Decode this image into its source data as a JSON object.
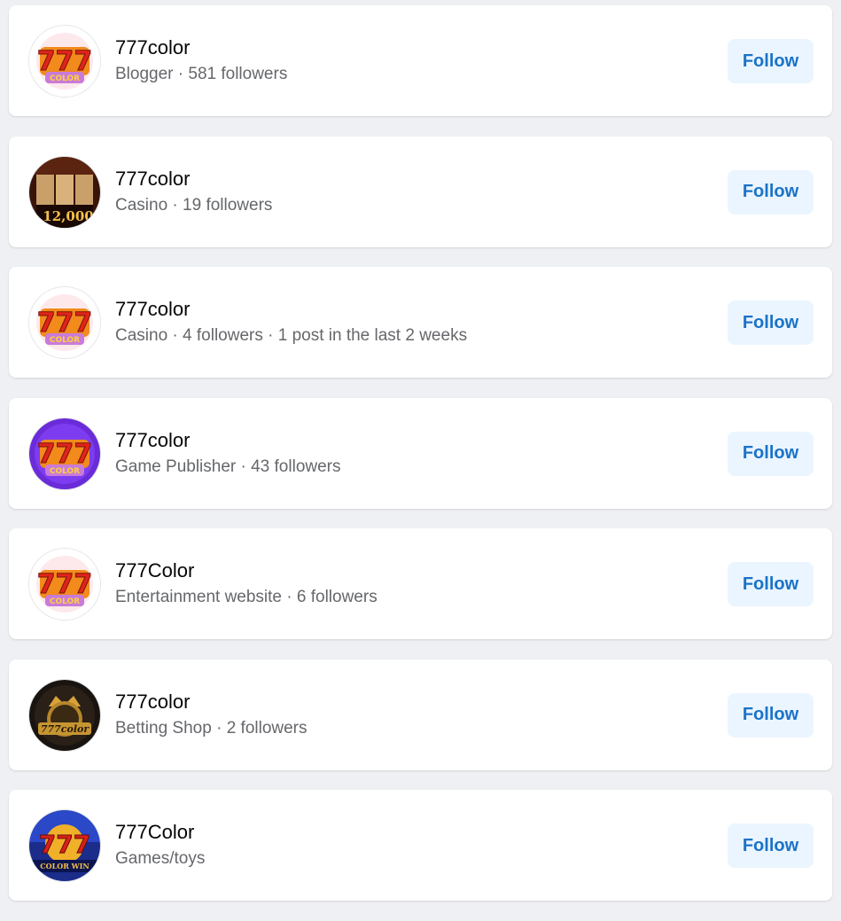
{
  "results": [
    {
      "name": "777color",
      "meta": "Blogger · 581 followers",
      "button": "Follow",
      "avatar": "slot-777-logo-white",
      "logo_text": "COLOR"
    },
    {
      "name": "777color",
      "meta": "Casino · 19 followers",
      "button": "Follow",
      "avatar": "casino-slot-reels-photo",
      "logo_text": "12,000"
    },
    {
      "name": "777color",
      "meta": "Casino · 4 followers · 1 post in the last 2 weeks",
      "button": "Follow",
      "avatar": "slot-777-logo-white",
      "logo_text": "COLOR"
    },
    {
      "name": "777color",
      "meta": "Game Publisher · 43 followers",
      "button": "Follow",
      "avatar": "slot-777-logo-purple",
      "logo_text": "COLOR"
    },
    {
      "name": "777Color",
      "meta": "Entertainment website · 6 followers",
      "button": "Follow",
      "avatar": "slot-777-logo-white",
      "logo_text": "COLOR"
    },
    {
      "name": "777color",
      "meta": "Betting Shop · 2 followers",
      "button": "Follow",
      "avatar": "gold-crown-badge",
      "logo_text": "777color"
    },
    {
      "name": "777Color",
      "meta": "Games/toys",
      "button": "Follow",
      "avatar": "777-blue-banner",
      "logo_text": "COLOR WIN"
    }
  ],
  "colors": {
    "page_background": "#eef0f3",
    "card_background": "#ffffff",
    "name_text": "#050505",
    "meta_text": "#65676b",
    "button_background": "#ebf5ff",
    "button_text": "#1a73c8"
  }
}
